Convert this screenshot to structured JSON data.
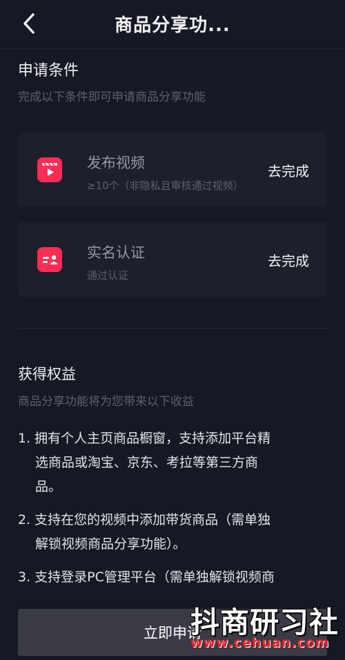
{
  "header": {
    "title": "商品分享功..."
  },
  "conditions": {
    "title": "申请条件",
    "subtitle": "完成以下条件即可申请商品分享功能",
    "items": [
      {
        "icon": "video-clapper-icon",
        "title": "发布视频",
        "desc": "≥10个（非隐私且审核通过视频）",
        "action": "去完成"
      },
      {
        "icon": "id-card-icon",
        "title": "实名认证",
        "desc": "通过认证",
        "action": "去完成"
      }
    ]
  },
  "benefits": {
    "title": "获得权益",
    "subtitle": "商品分享功能将为您带来以下收益",
    "items": [
      {
        "line1": "1. 拥有个人主页商品橱窗，支持添加平台精",
        "line2": "选商品或淘宝、京东、考拉等第三方商",
        "line3": "品。"
      },
      {
        "line1": "2. 支持在您的视频中添加带货商品（需单独",
        "line2": "解锁视频商品分享功能）。"
      },
      {
        "line1": "3. 支持登录PC管理平台（需单独解锁视频商"
      }
    ]
  },
  "apply_button": {
    "label": "立即申请"
  },
  "watermark": {
    "main": "抖商研习社",
    "url": "www.cehuan.com"
  },
  "colors": {
    "background": "#161823",
    "card": "#1d1f2b",
    "accent": "#fe2c55",
    "button": "#3a3b45"
  }
}
